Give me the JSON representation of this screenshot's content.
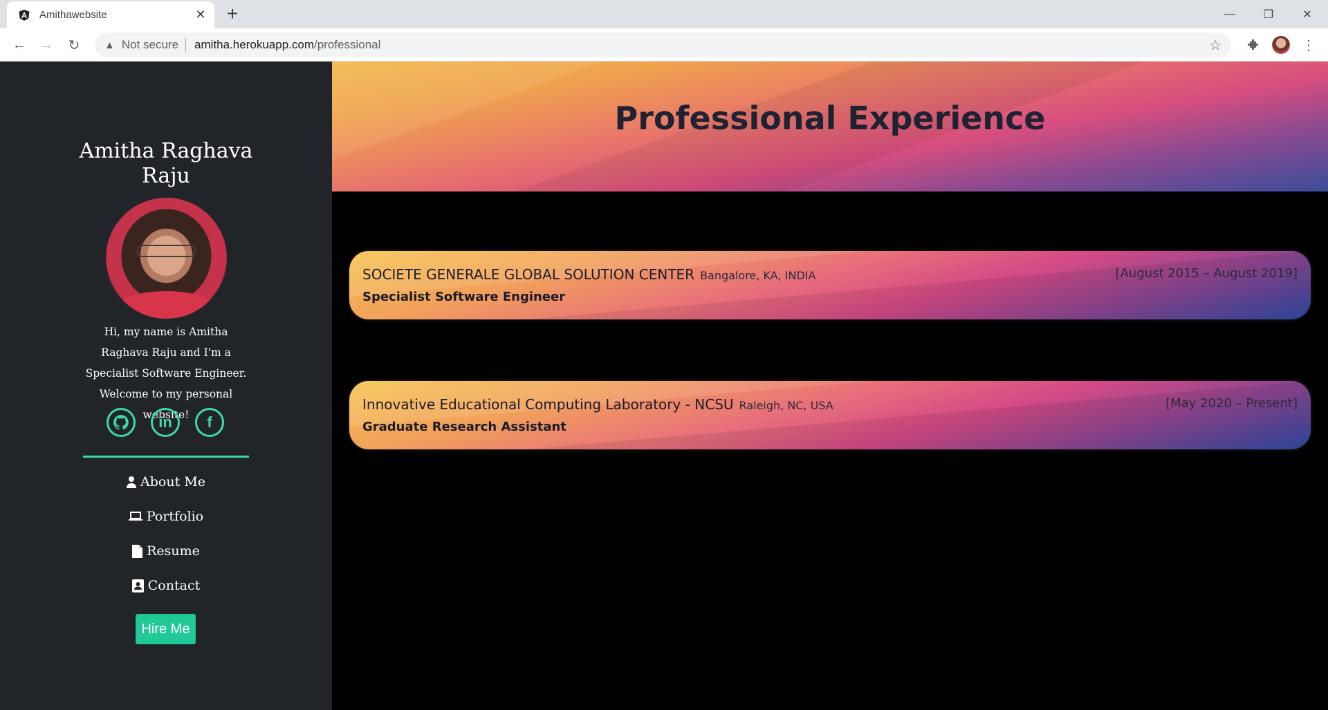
{
  "browser": {
    "tab_title": "Amithawebsite",
    "address_warning": "Not secure",
    "address_host": "amitha.herokuapp.com",
    "address_path": "/professional"
  },
  "sidebar": {
    "name": "Amitha Raghava Raju",
    "bio": "Hi, my name is Amitha Raghava Raju and I'm a Specialist Software Engineer. Welcome to my personal website!",
    "social": [
      {
        "icon": "github-icon"
      },
      {
        "icon": "linkedin-icon"
      },
      {
        "icon": "facebook-icon"
      }
    ],
    "nav": [
      {
        "label": "About Me",
        "icon": "user-icon"
      },
      {
        "label": "Portfolio",
        "icon": "laptop-icon"
      },
      {
        "label": "Resume",
        "icon": "file-icon"
      },
      {
        "label": "Contact",
        "icon": "address-book-icon"
      }
    ],
    "hire_label": "Hire Me",
    "accent_color": "#20c997"
  },
  "main": {
    "title": "Professional Experience",
    "experience": [
      {
        "company": "SOCIETE GENERALE GLOBAL SOLUTION CENTER",
        "location": "Bangalore, KA, INDIA",
        "dates": "[August 2015 – August 2019]",
        "role": "Specialist Software Engineer"
      },
      {
        "company": "Innovative Educational Computing Laboratory - NCSU",
        "location": "Raleigh, NC, USA",
        "dates": "[May 2020 – Present]",
        "role": "Graduate Research Assistant"
      }
    ]
  }
}
